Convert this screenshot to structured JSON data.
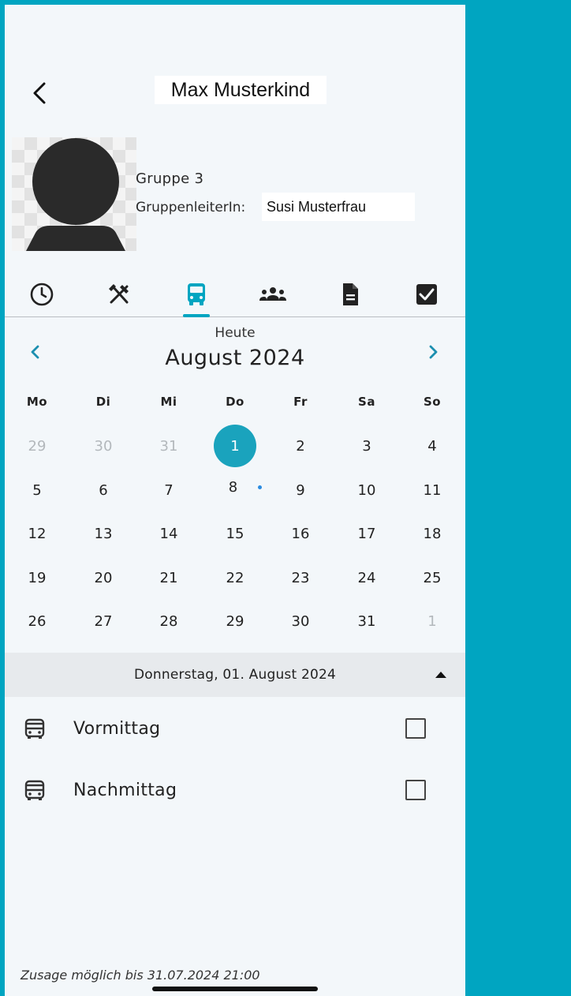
{
  "header": {
    "title": "Max Musterkind"
  },
  "profile": {
    "group": "Gruppe 3",
    "leader_label": "GruppenleiterIn:",
    "leader_name": "Susi Musterfrau"
  },
  "tabs": [
    {
      "icon": "clock-icon"
    },
    {
      "icon": "fork-knife-icon"
    },
    {
      "icon": "bus-icon",
      "active": true
    },
    {
      "icon": "group-icon"
    },
    {
      "icon": "document-icon"
    },
    {
      "icon": "checkbox-icon"
    }
  ],
  "calendar": {
    "today_label": "Heute",
    "month_label": "August 2024",
    "weekdays": [
      "Mo",
      "Di",
      "Mi",
      "Do",
      "Fr",
      "Sa",
      "So"
    ],
    "weeks": [
      [
        "29",
        "30",
        "31",
        "1",
        "2",
        "3",
        "4"
      ],
      [
        "5",
        "6",
        "7",
        "8",
        "9",
        "10",
        "11"
      ],
      [
        "12",
        "13",
        "14",
        "15",
        "16",
        "17",
        "18"
      ],
      [
        "19",
        "20",
        "21",
        "22",
        "23",
        "24",
        "25"
      ],
      [
        "26",
        "27",
        "28",
        "29",
        "30",
        "31",
        "1"
      ]
    ],
    "muted_days": [
      "0-0",
      "0-1",
      "0-2",
      "4-6"
    ],
    "selected_day": "0-3",
    "marked_days": [
      "1-3"
    ]
  },
  "selected_date": {
    "label": "Donnerstag, 01. August 2024"
  },
  "slots": [
    {
      "label": "Vormittag",
      "checked": false
    },
    {
      "label": "Nachmittag",
      "checked": false
    }
  ],
  "footer": {
    "deadline": "Zusage möglich bis 31.07.2024 21:00"
  },
  "colors": {
    "accent": "#00a5c1",
    "selected_day": "#1aa3bd",
    "event_dot": "#2a8be0",
    "background": "#f3f7fa"
  }
}
